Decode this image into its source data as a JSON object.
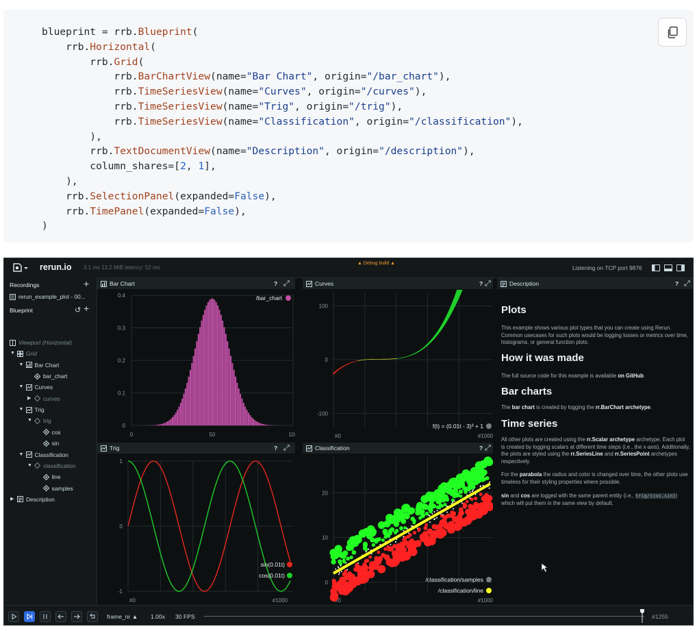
{
  "code": {
    "lines": [
      [
        [
          "p",
          "blueprint = rrb."
        ],
        [
          "f",
          "Blueprint"
        ],
        [
          "p",
          "("
        ]
      ],
      [
        [
          "p",
          "    rrb."
        ],
        [
          "f",
          "Horizontal"
        ],
        [
          "p",
          "("
        ]
      ],
      [
        [
          "p",
          "        rrb."
        ],
        [
          "f",
          "Grid"
        ],
        [
          "p",
          "("
        ]
      ],
      [
        [
          "p",
          "            rrb."
        ],
        [
          "f",
          "BarChartView"
        ],
        [
          "p",
          "(name="
        ],
        [
          "s",
          "\"Bar Chart\""
        ],
        [
          "p",
          ", origin="
        ],
        [
          "s",
          "\"/bar_chart\""
        ],
        [
          "p",
          "),"
        ]
      ],
      [
        [
          "p",
          "            rrb."
        ],
        [
          "f",
          "TimeSeriesView"
        ],
        [
          "p",
          "(name="
        ],
        [
          "s",
          "\"Curves\""
        ],
        [
          "p",
          ", origin="
        ],
        [
          "s",
          "\"/curves\""
        ],
        [
          "p",
          "),"
        ]
      ],
      [
        [
          "p",
          "            rrb."
        ],
        [
          "f",
          "TimeSeriesView"
        ],
        [
          "p",
          "(name="
        ],
        [
          "s",
          "\"Trig\""
        ],
        [
          "p",
          ", origin="
        ],
        [
          "s",
          "\"/trig\""
        ],
        [
          "p",
          "),"
        ]
      ],
      [
        [
          "p",
          "            rrb."
        ],
        [
          "f",
          "TimeSeriesView"
        ],
        [
          "p",
          "(name="
        ],
        [
          "s",
          "\"Classification\""
        ],
        [
          "p",
          ", origin="
        ],
        [
          "s",
          "\"/classification\""
        ],
        [
          "p",
          "),"
        ]
      ],
      [
        [
          "p",
          "        ),"
        ]
      ],
      [
        [
          "p",
          "        rrb."
        ],
        [
          "f",
          "TextDocumentView"
        ],
        [
          "p",
          "(name="
        ],
        [
          "s",
          "\"Description\""
        ],
        [
          "p",
          ", origin="
        ],
        [
          "s",
          "\"/description\""
        ],
        [
          "p",
          "),"
        ]
      ],
      [
        [
          "p",
          "        column_shares=["
        ],
        [
          "n",
          "2"
        ],
        [
          "p",
          ", "
        ],
        [
          "n",
          "1"
        ],
        [
          "p",
          "],"
        ]
      ],
      [
        [
          "p",
          "    ),"
        ]
      ],
      [
        [
          "p",
          "    rrb."
        ],
        [
          "f",
          "SelectionPanel"
        ],
        [
          "p",
          "(expanded="
        ],
        [
          "k",
          "False"
        ],
        [
          "p",
          "),"
        ]
      ],
      [
        [
          "p",
          "    rrb."
        ],
        [
          "f",
          "TimePanel"
        ],
        [
          "p",
          "(expanded="
        ],
        [
          "k",
          "False"
        ],
        [
          "p",
          "),"
        ]
      ],
      [
        [
          "p",
          ")"
        ]
      ]
    ]
  },
  "topbar": {
    "app_name": "rerun.io",
    "stats": "3.1 ms  13.2 MiB  latency: 52 ms",
    "debug": "▲ Debug build ▲",
    "listening": "Listening on TCP port 9876"
  },
  "recordings": {
    "title": "Recordings",
    "item": "rerun_example_plot - 00..."
  },
  "blueprint": {
    "title": "Blueprint",
    "tree": [
      {
        "label": "Viewport (Horizontal)",
        "indent": 0,
        "icon": "viewport",
        "arrow": "",
        "dim": true,
        "italic": true
      },
      {
        "label": "Grid",
        "indent": 0,
        "icon": "grid",
        "arrow": "down",
        "dim": true,
        "italic": true
      },
      {
        "label": "Bar Chart",
        "indent": 1,
        "icon": "bar",
        "arrow": "down",
        "dim": false,
        "italic": false
      },
      {
        "label": "bar_chart",
        "indent": 2,
        "icon": "entity",
        "arrow": "",
        "dim": false,
        "italic": false
      },
      {
        "label": "Curves",
        "indent": 1,
        "icon": "ts",
        "arrow": "down",
        "dim": false,
        "italic": false
      },
      {
        "label": "curves",
        "indent": 2,
        "icon": "group",
        "arrow": "right",
        "dim": true,
        "italic": false
      },
      {
        "label": "Trig",
        "indent": 1,
        "icon": "ts",
        "arrow": "down",
        "dim": false,
        "italic": false
      },
      {
        "label": "trig",
        "indent": 2,
        "icon": "group",
        "arrow": "down",
        "dim": true,
        "italic": false
      },
      {
        "label": "cos",
        "indent": 3,
        "icon": "entity",
        "arrow": "",
        "dim": false,
        "italic": false
      },
      {
        "label": "sin",
        "indent": 3,
        "icon": "entity",
        "arrow": "",
        "dim": false,
        "italic": false
      },
      {
        "label": "Classification",
        "indent": 1,
        "icon": "ts",
        "arrow": "down",
        "dim": false,
        "italic": false
      },
      {
        "label": "classification",
        "indent": 2,
        "icon": "group",
        "arrow": "down",
        "dim": true,
        "italic": false
      },
      {
        "label": "line",
        "indent": 3,
        "icon": "entity",
        "arrow": "",
        "dim": false,
        "italic": false
      },
      {
        "label": "samples",
        "indent": 3,
        "icon": "entity",
        "arrow": "",
        "dim": false,
        "italic": false
      },
      {
        "label": "Description",
        "indent": 0,
        "icon": "doc",
        "arrow": "right",
        "dim": false,
        "italic": false
      }
    ]
  },
  "panels": {
    "bar": {
      "title": "Bar Chart",
      "help": "?"
    },
    "curves": {
      "title": "Curves",
      "help": "?"
    },
    "trig": {
      "title": "Trig",
      "help": "?"
    },
    "classification": {
      "title": "Classification",
      "help": "?"
    },
    "description": {
      "title": "Description",
      "help": "?"
    }
  },
  "description": {
    "h_plots": "Plots",
    "p_plots": "This example shows various plot types that you can create using Rerun. Common usecases for such plots would be logging losses or metrics over time, histograms, or general function plots.",
    "h_how": "How it was made",
    "p_how_a": "The full source code for this example is available ",
    "p_how_link": "on GitHub",
    "p_how_b": ".",
    "h_bar": "Bar charts",
    "p_bar_a": "The ",
    "p_bar_b1": "bar chart",
    "p_bar_c": " is created by logging the ",
    "p_bar_b2": "rr.BarChart archetype",
    "p_bar_d": ".",
    "h_ts": "Time series",
    "p_ts1_a": "All other plots are created using the ",
    "p_ts1_b1": "rr.Scalar archetype",
    "p_ts1_c": " archetype. Each plot is created by logging scalars at different time steps (i.e., the x-axis). Additionally, the plots are styled using the ",
    "p_ts1_b2": "rr.SeriesLine",
    "p_ts1_d": " and ",
    "p_ts1_b3": "rr.SeriesPoint",
    "p_ts1_e": " archetypes respectively.",
    "p_ts2_a": "For the ",
    "p_ts2_b": "parabola",
    "p_ts2_c": " the radius and color is changed over time, the other plots use timeless for their styling properties where possible.",
    "p_ts3_b1": "sin",
    "p_ts3_a": " and ",
    "p_ts3_b2": "cos",
    "p_ts3_c": " are logged with the same parent entity (i.e., ",
    "p_ts3_code": "trig/{cos,sin}",
    "p_ts3_d": ") which will put them in the same view by default."
  },
  "timeline": {
    "timeline_name": "frame_nr ▲",
    "speed": "1.00x",
    "fps": "30 FPS",
    "frame": "#1255",
    "progress": 0.995
  },
  "chart_data": [
    {
      "type": "bar",
      "panel": "Bar Chart",
      "xlim": [
        0,
        100
      ],
      "ylim": [
        0,
        0.4
      ],
      "x_ticks": [
        "0",
        "50",
        "100"
      ],
      "y_ticks": [
        "0",
        "0.1",
        "0.2",
        "0.3",
        "0.4"
      ],
      "legend": [
        "/bar_chart"
      ],
      "bar_color": "#c04fa6",
      "distribution": {
        "kind": "gaussian",
        "count": 100,
        "center": 50,
        "sigma": 10.5,
        "peak": 0.39
      }
    },
    {
      "type": "line",
      "panel": "Curves",
      "x_ticks": [
        "#0",
        "#1000"
      ],
      "y_ticks": [
        "100",
        "0",
        "-100"
      ],
      "ylim": [
        -125,
        125
      ],
      "legend": [
        "f(t) = (0.01t - 3)³ + 1"
      ],
      "function": "(0.01t-3)^3+1",
      "t_range": [
        0,
        1000
      ]
    },
    {
      "type": "line",
      "panel": "Trig",
      "x_ticks": [
        "#0",
        "#1000"
      ],
      "y_ticks": [
        "1",
        "0",
        "-1"
      ],
      "ylim": [
        -1,
        1
      ],
      "series": [
        {
          "name": "sin(0.01t)",
          "color": "#e8281e",
          "function": "sin(0.01t)"
        },
        {
          "name": "cos(0.01t)",
          "color": "#1fcf2a",
          "function": "cos(0.01t)"
        }
      ],
      "t_range": [
        0,
        1000
      ]
    },
    {
      "type": "scatter",
      "panel": "Classification",
      "x_ticks": [
        "#0",
        "#1000"
      ],
      "y_ticks": [
        "20",
        "10",
        "0"
      ],
      "ylim": [
        -2,
        28
      ],
      "legend": [
        "/classification/samples",
        "/classification/line"
      ],
      "line": {
        "color": "#ffff22",
        "slope": 0.02,
        "intercept": 2
      },
      "samples": {
        "above_color": "#22ff22",
        "below_color": "#ff2222",
        "boundary_color": "#ffffff"
      }
    }
  ],
  "colors": {
    "bg": "#0d1011",
    "panel_header": "#1b2224",
    "accent": "#2c6be0",
    "green": "#1fcf2a",
    "red": "#e8281e",
    "yellow": "#ffff22",
    "magenta": "#c04fa6"
  }
}
